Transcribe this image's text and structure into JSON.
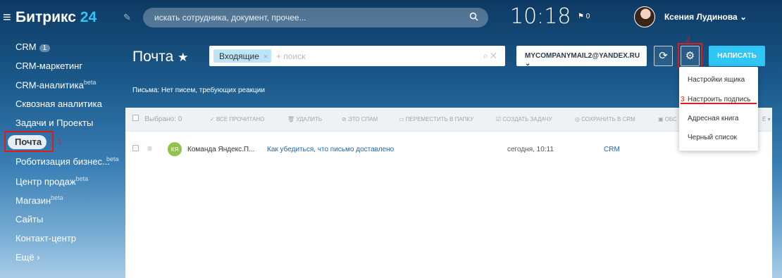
{
  "app": {
    "logo_main": "Битрикс",
    "logo_num": "24"
  },
  "topbar": {
    "search_placeholder": "искать сотрудника, документ, прочее...",
    "time": "10:18",
    "flag_count": "0",
    "user_name": "Ксения Лудинова"
  },
  "sidebar": {
    "items": [
      {
        "label": "CRM",
        "badge": "1",
        "sup": ""
      },
      {
        "label": "CRM-маркетинг",
        "sup": ""
      },
      {
        "label": "CRM-аналитика",
        "sup": "beta"
      },
      {
        "label": "Сквозная аналитика",
        "sup": ""
      },
      {
        "label": "Задачи и Проекты",
        "sup": ""
      },
      {
        "label": "Почта",
        "sup": ""
      },
      {
        "label": "Роботизация бизнес...",
        "sup": "beta"
      },
      {
        "label": "Центр продаж",
        "sup": "beta"
      },
      {
        "label": "Магазин",
        "sup": "beta"
      },
      {
        "label": "Сайты",
        "sup": ""
      },
      {
        "label": "Контакт-центр",
        "sup": ""
      },
      {
        "label": "Ещё",
        "sup": ""
      }
    ]
  },
  "annotations": {
    "n1": "1",
    "n2": "2",
    "n3": "3"
  },
  "main": {
    "title": "Почта",
    "filter_chip": "Входящие",
    "filter_placeholder": "+ поиск",
    "mailbox": "MYCOMPANYMAIL2@YANDEX.RU",
    "write_button": "НАПИСАТЬ",
    "subinfo": "Письма: Нет писем, требующих реакции"
  },
  "toolbar": {
    "selected": "Выбрано: 0",
    "all_read": "ВСЕ ПРОЧИТАНО",
    "delete": "УДАЛИТЬ",
    "spam": "ЭТО СПАМ",
    "move": "ПЕРЕМЕСТИТЬ В ПАПКУ",
    "task": "СОЗДАТЬ ЗАДАЧУ",
    "save_crm": "СОХРАНИТЬ В CRM",
    "more_cut": "ОБС",
    "more2": "Ё"
  },
  "messages": [
    {
      "initials": "КЯ",
      "sender": "Команда Яндекс.П...",
      "subject": "Как убедиться, что письмо доставлено",
      "date": "сегодня, 10:11",
      "crm": "CRM"
    }
  ],
  "dropdown": {
    "items": [
      "Настройки ящика",
      "Настроить подпись",
      "Адресная книга",
      "Черный список"
    ]
  },
  "colors": {
    "accent": "#2fc6f6",
    "highlight": "#e11a1a"
  }
}
